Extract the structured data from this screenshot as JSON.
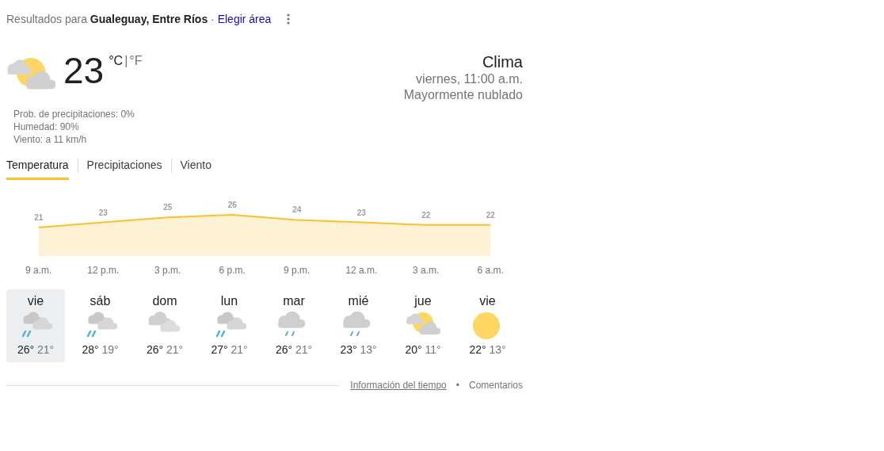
{
  "header": {
    "prefix": "Resultados para ",
    "location": "Gualeguay, Entre Ríos",
    "separator": " · ",
    "change_link": "Elegir área"
  },
  "current": {
    "kind": "partly_sunny",
    "temperature": "23",
    "units": [
      {
        "label": "°C",
        "selected": true
      },
      {
        "label": "°F",
        "selected": false
      }
    ],
    "divider": "|",
    "details": [
      "Prob. de precipitaciones: 0%",
      "Humedad: 90%",
      "Viento: a 11 km/h"
    ],
    "title": "Clima",
    "time": "viernes, 11:00 a.m.",
    "condition": "Mayormente nublado"
  },
  "tabs": [
    {
      "label": "Temperatura",
      "selected": true
    },
    {
      "label": "Precipitaciones",
      "selected": false
    },
    {
      "label": "Viento",
      "selected": false
    }
  ],
  "temperature_chart": {
    "chart_data": {
      "type": "area",
      "categories": [
        "9 a.m.",
        "12 p.m.",
        "3 p.m.",
        "6 p.m.",
        "9 p.m.",
        "12 a.m.",
        "3 a.m.",
        "6 a.m."
      ],
      "series": [
        {
          "color": "#fbc02d",
          "values": [
            21,
            23,
            25,
            26,
            24,
            23,
            22,
            22
          ]
        }
      ],
      "data_labels": true
    }
  },
  "days": [
    {
      "name": "vie",
      "kind": "rain",
      "high": "26°",
      "low": "21°",
      "selected": true
    },
    {
      "name": "sáb",
      "kind": "rain",
      "high": "28°",
      "low": "19°",
      "selected": false
    },
    {
      "name": "dom",
      "kind": "cloudy",
      "high": "26°",
      "low": "21°",
      "selected": false
    },
    {
      "name": "lun",
      "kind": "rain",
      "high": "27°",
      "low": "21°",
      "selected": false
    },
    {
      "name": "mar",
      "kind": "showers",
      "high": "26°",
      "low": "21°",
      "selected": false
    },
    {
      "name": "mié",
      "kind": "showers",
      "high": "23°",
      "low": "13°",
      "selected": false
    },
    {
      "name": "jue",
      "kind": "partly_sunny",
      "high": "20°",
      "low": "11°",
      "selected": false
    },
    {
      "name": "vie",
      "kind": "sunny",
      "high": "22°",
      "low": "13°",
      "selected": false
    }
  ],
  "footer": {
    "info_link": "Información del tiempo",
    "bullet": "•",
    "feedback_link": "Comentarios"
  }
}
